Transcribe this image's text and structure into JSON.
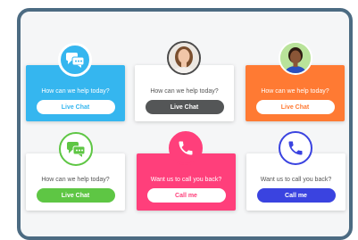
{
  "colors": {
    "frame": "#4c6b82",
    "blue": "#35b6ef",
    "orange": "#ff7a33",
    "pink": "#ff3f7b",
    "green": "#5ec644",
    "indigo": "#3a43e0",
    "dark": "#545657"
  },
  "widgets": [
    {
      "question": "How can we help today?",
      "button": "Live Chat",
      "icon": "chat-icon"
    },
    {
      "question": "How can we help today?",
      "button": "Live Chat",
      "icon": "avatar-woman"
    },
    {
      "question": "How can we help today?",
      "button": "Live Chat",
      "icon": "avatar-woman-smiling"
    },
    {
      "question": "How can we help today?",
      "button": "Live Chat",
      "icon": "chat-icon"
    },
    {
      "question": "Want us to call you back?",
      "button": "Call me",
      "icon": "phone-icon"
    },
    {
      "question": "Want us to call you back?",
      "button": "Call me",
      "icon": "phone-icon"
    }
  ]
}
